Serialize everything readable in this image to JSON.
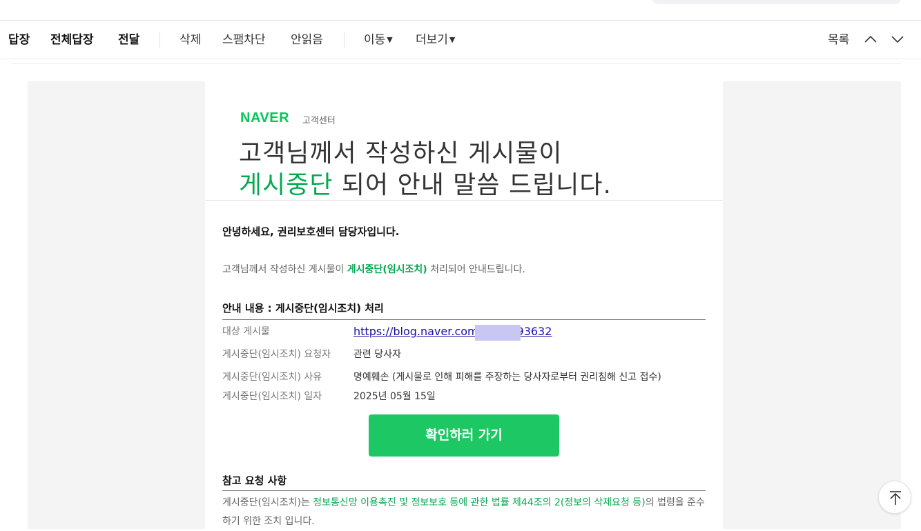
{
  "toolbar": {
    "reply": "답장",
    "reply_all": "전체답장",
    "forward": "전달",
    "delete": "삭제",
    "spam_block": "스팸차단",
    "mark_unread": "안읽음",
    "move": "이동",
    "more": "더보기",
    "list": "목록"
  },
  "mail": {
    "brand": "NAVER",
    "brand_sub": "고객센터",
    "headline_line1": "고객님께서 작성하신 게시물이",
    "headline_line2_green": "게시중단",
    "headline_line2_rest": " 되어 안내 말씀 드립니다.",
    "greeting": "안녕하세요, 권리보호센터 담당자입니다.",
    "intro_pre": "고객님께서 작성하신 게시물이 ",
    "intro_highlight": "게시중단(임시조치)",
    "intro_post": " 처리되어 안내드립니다.",
    "section1_title": "안내 내용 : 게시중단(임시조치) 처리",
    "rows": [
      {
        "label": "대상 게시물",
        "value": "https://blog.naver.com         a/ 10293632"
      },
      {
        "label": "게시중단(임시조치) 요청자",
        "value": "관련 당사자"
      },
      {
        "label": "게시중단(임시조치) 사유",
        "value": "명예훼손 (게시물로 인해 피해를 주장하는 당사자로부터 권리침해 신고 접수)"
      },
      {
        "label": "게시중단(임시조치) 일자",
        "value": "2025년 05월 15일"
      }
    ],
    "cta_label": "확인하러 가기",
    "section2_title": "참고 요청 사항",
    "note_pre": "게시중단(임시조치)는 ",
    "note_green": "정보통신망 이용촉진 및 정보보호 등에 관한 법률 제44조의 2(정보의 삭제요청 등)",
    "note_post": "의 법령을 준수하기 위한 조치 입니다."
  },
  "colors": {
    "naver_green": "#03c75a",
    "highlight_green": "#03a94f",
    "cta_green": "#1dc763",
    "link_blue": "#1a0dab"
  },
  "icons": {
    "prev": "chevron-up-icon",
    "next": "chevron-down-icon",
    "scroll_top": "arrow-up-to-top-icon"
  }
}
